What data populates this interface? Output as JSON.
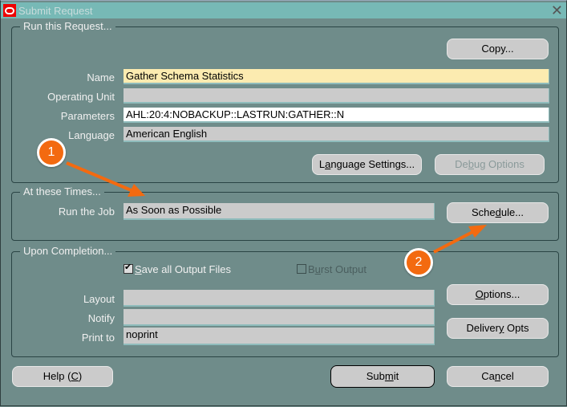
{
  "window": {
    "title": "Submit Request",
    "logo_icon": "oracle-logo-icon",
    "close_icon": "close-icon",
    "close_glyph": "✕"
  },
  "run_request": {
    "group_label": "Run this Request...",
    "copy_button": "Copy...",
    "fields": {
      "name": {
        "label": "Name",
        "value": "Gather Schema Statistics"
      },
      "operating_unit": {
        "label": "Operating Unit",
        "value": ""
      },
      "parameters": {
        "label": "Parameters",
        "value": "AHL:20:4:NOBACKUP::LASTRUN:GATHER::N"
      },
      "language": {
        "label": "Language",
        "value": "American English"
      }
    },
    "language_settings_button": {
      "pre": "L",
      "underline": "a",
      "post": "nguage Settings..."
    },
    "debug_options_button": {
      "pre": "De",
      "underline": "b",
      "post": "ug Options"
    }
  },
  "at_these_times": {
    "group_label": "At these Times...",
    "run_the_job": {
      "label": "Run the Job",
      "value": "As Soon as Possible"
    },
    "schedule_button": {
      "pre": "Sche",
      "underline": "d",
      "post": "ule..."
    }
  },
  "upon_completion": {
    "group_label": "Upon Completion...",
    "save_output": {
      "underline": "S",
      "post": "ave all Output Files",
      "checked": true
    },
    "burst_output": {
      "pre": "B",
      "underline": "u",
      "post": "rst Output",
      "checked": false
    },
    "layout": {
      "label": "Layout",
      "value": ""
    },
    "notify": {
      "label": "Notify",
      "value": ""
    },
    "print_to": {
      "label": "Print to",
      "value": "noprint"
    },
    "options_button": {
      "underline": "O",
      "post": "ptions..."
    },
    "delivery_opts_button": {
      "pre": "Deliver",
      "underline": "y",
      "post": " Opts"
    }
  },
  "footer": {
    "help_button": {
      "pre": "Help (",
      "underline": "C",
      "post": ")"
    },
    "submit_button": {
      "pre": "Sub",
      "underline": "m",
      "post": "it"
    },
    "cancel_button": {
      "pre": "Ca",
      "underline": "n",
      "post": "cel"
    }
  },
  "annotations": {
    "callout_1": "1",
    "callout_2": "2",
    "accent_color": "#f36a10"
  }
}
